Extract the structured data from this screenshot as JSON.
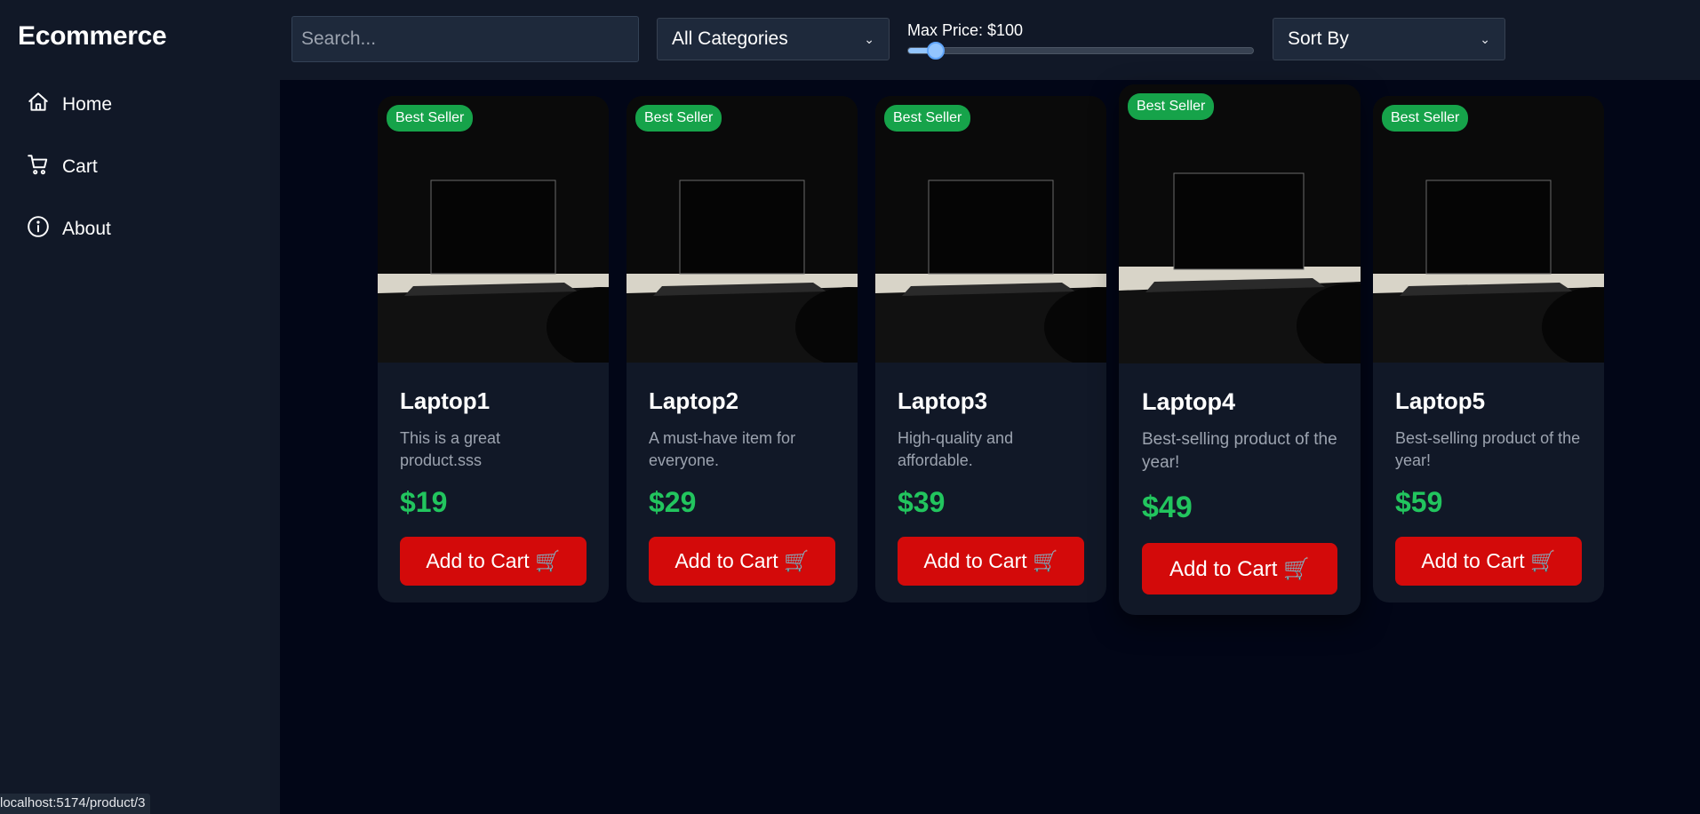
{
  "app": {
    "brand": "Ecommerce"
  },
  "sidebar": {
    "items": [
      {
        "label": "Home",
        "icon": "home-icon"
      },
      {
        "label": "Cart",
        "icon": "cart-icon"
      },
      {
        "label": "About",
        "icon": "info-icon"
      }
    ]
  },
  "toolbar": {
    "search_placeholder": "Search...",
    "category_value": "All Categories",
    "price_label": "Max Price: $100",
    "price_slider_value_fraction": 0.08,
    "sort_value": "Sort By"
  },
  "products": [
    {
      "badge": "Best Seller",
      "title": "Laptop1",
      "desc": "This is a great product.sss",
      "price": "$19",
      "button": "Add to Cart 🛒"
    },
    {
      "badge": "Best Seller",
      "title": "Laptop2",
      "desc": "A must-have item for everyone.",
      "price": "$29",
      "button": "Add to Cart 🛒"
    },
    {
      "badge": "Best Seller",
      "title": "Laptop3",
      "desc": "High-quality and affordable.",
      "price": "$39",
      "button": "Add to Cart 🛒"
    },
    {
      "badge": "Best Seller",
      "title": "Laptop4",
      "desc": "Best-selling product of the year!",
      "price": "$49",
      "button": "Add to Cart 🛒"
    },
    {
      "badge": "Best Seller",
      "title": "Laptop5",
      "desc": "Best-selling product of the year!",
      "price": "$59",
      "button": "Add to Cart 🛒"
    }
  ],
  "status_bar": {
    "url": "localhost:5174/product/3"
  },
  "colors": {
    "background": "#020617",
    "panel": "#111827",
    "accent_green": "#22c55e",
    "badge_green": "#16a34a",
    "button_red": "#d30a0a"
  }
}
